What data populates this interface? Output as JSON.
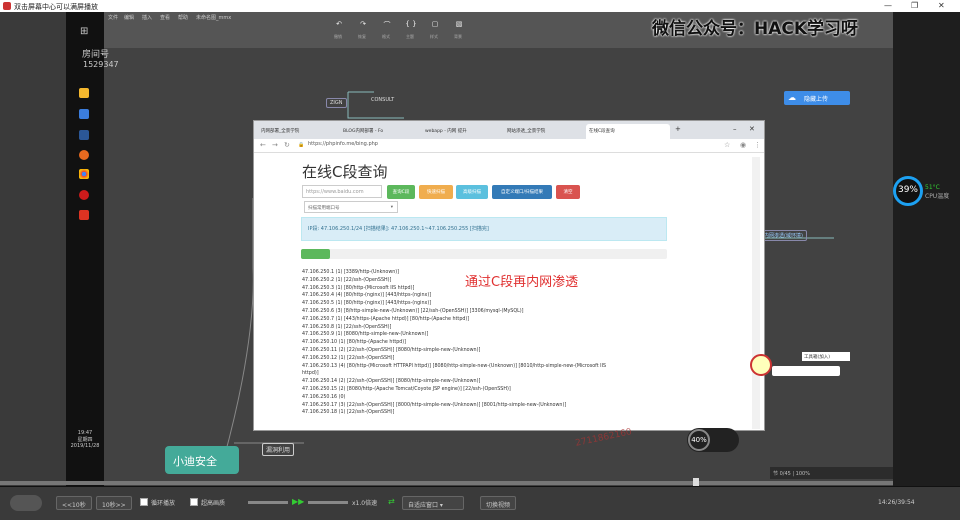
{
  "window": {
    "title": "双击屏幕中心可以满屏播放"
  },
  "watermark": "微信公众号：HACK学习呀",
  "room": {
    "label": "房间号",
    "number": "1529347"
  },
  "mindmap": {
    "menu": [
      "文件",
      "编辑",
      "插入",
      "查看",
      "帮助",
      "未命名图_mmx"
    ],
    "toolbar_labels": [
      "撤销",
      "恢复",
      "格式",
      "主题",
      "样式",
      "背景"
    ],
    "nodes": [
      "ZIGN",
      "CONSULT",
      "小迪安全",
      "漏洞利用"
    ],
    "upload_btn": "隐藏上传",
    "side_node": "内网渗透(域环境)"
  },
  "browser": {
    "tabs": [
      "内网部署_全景学院",
      "BLOG内网部署 - Fo",
      "webapp - 内网 提升",
      "网站渗透_全景学院",
      "在线C段查询"
    ],
    "url": "https://phpinfo.me/bing.php",
    "page": {
      "heading": "在线C段查询",
      "input_placeholder": "https://www.baidu.com",
      "select_label": "扫描常用端口号",
      "buttons": [
        {
          "label": "查询C段",
          "color": "#5cb85c"
        },
        {
          "label": "快速扫描",
          "color": "#f0ad4e"
        },
        {
          "label": "高级扫描",
          "color": "#5bc0de"
        },
        {
          "label": "自定义端口/扫描结果",
          "color": "#337ab7"
        },
        {
          "label": "清空",
          "color": "#d9534f"
        }
      ],
      "info": "IP段: 47.106.250.1/24  [扫描结果]: 47.106.250.1~47.106.250.255  [扫描完]",
      "progress": 0.08,
      "results": [
        "47.106.250.1 (1) [3389/http-(Unknown)]",
        "47.106.250.2 (1) [22/ssh-(OpenSSH)]",
        "47.106.250.3 (1) [80/http-(Microsoft IIS httpd)]",
        "47.106.250.4 (4) [80/http-(nginx)] [443/https-(nginx)]",
        "47.106.250.5 (1) [80/http-(nginx)] [443/https-(nginx)]",
        "47.106.250.6 (3) [8/http-simple-new-(Unknown)] [22/ssh-(OpenSSH)] [3306/mysql-(MySQL)]",
        "47.106.250.7 (1) [443/https-(Apache httpd)] [80/http-(Apache httpd)]",
        "47.106.250.8 (1) [22/ssh-(OpenSSH)]",
        "47.106.250.9 (1) [8080/http-simple-new-(Unknown)]",
        "47.106.250.10 (1) [80/http-(Apache httpd)]",
        "47.106.250.11 (2) [22/ssh-(OpenSSH)] [8080/http-simple-new-(Unknown)]",
        "47.106.250.12 (1) [22/ssh-(OpenSSH)]",
        "47.106.250.13 (4) [80/http-(Microsoft HTTPAPI httpd)] [8080/http-simple-new-(Unknown)] [8010/http-simple-new-(Microsoft IIS",
        "httpd)]",
        "47.106.250.14 (2) [22/ssh-(OpenSSH)] [8080/http-simple-new-(Unknown)]",
        "47.106.250.15 (2) [8080/http-(Apache Tomcat/Coyote JSP engine)] [22/ssh-(OpenSSH)]",
        "47.106.250.16 (0)",
        "47.106.250.17 (3) [22/ssh-(OpenSSH)] [8000/http-simple-new-(Unknown)] [8001/http-simple-new-(Unknown)]",
        "47.106.250.18 (1) [22/ssh-(OpenSSH)]"
      ]
    }
  },
  "caption": "通过C段再内网渗透",
  "cpu": {
    "percent": "39%",
    "temp": "51°C",
    "label": "CPU温度"
  },
  "taskbar_clock": {
    "time": "19:47",
    "day": "星期四",
    "date": "2019/11/28"
  },
  "meter": {
    "value": "40%"
  },
  "float_tip": "工具箱(加入)",
  "zoom_bar": "节 0/45  |  100%",
  "player": {
    "back10": "<<10秒",
    "fwd10": "10秒>>",
    "loop": "循环播放",
    "hd": "超高画质",
    "speed": "x1.0倍速",
    "fit": "自适应窗口",
    "switch": "切换视频",
    "time": "14:26/39:54"
  },
  "red_watermark": "2711862160"
}
